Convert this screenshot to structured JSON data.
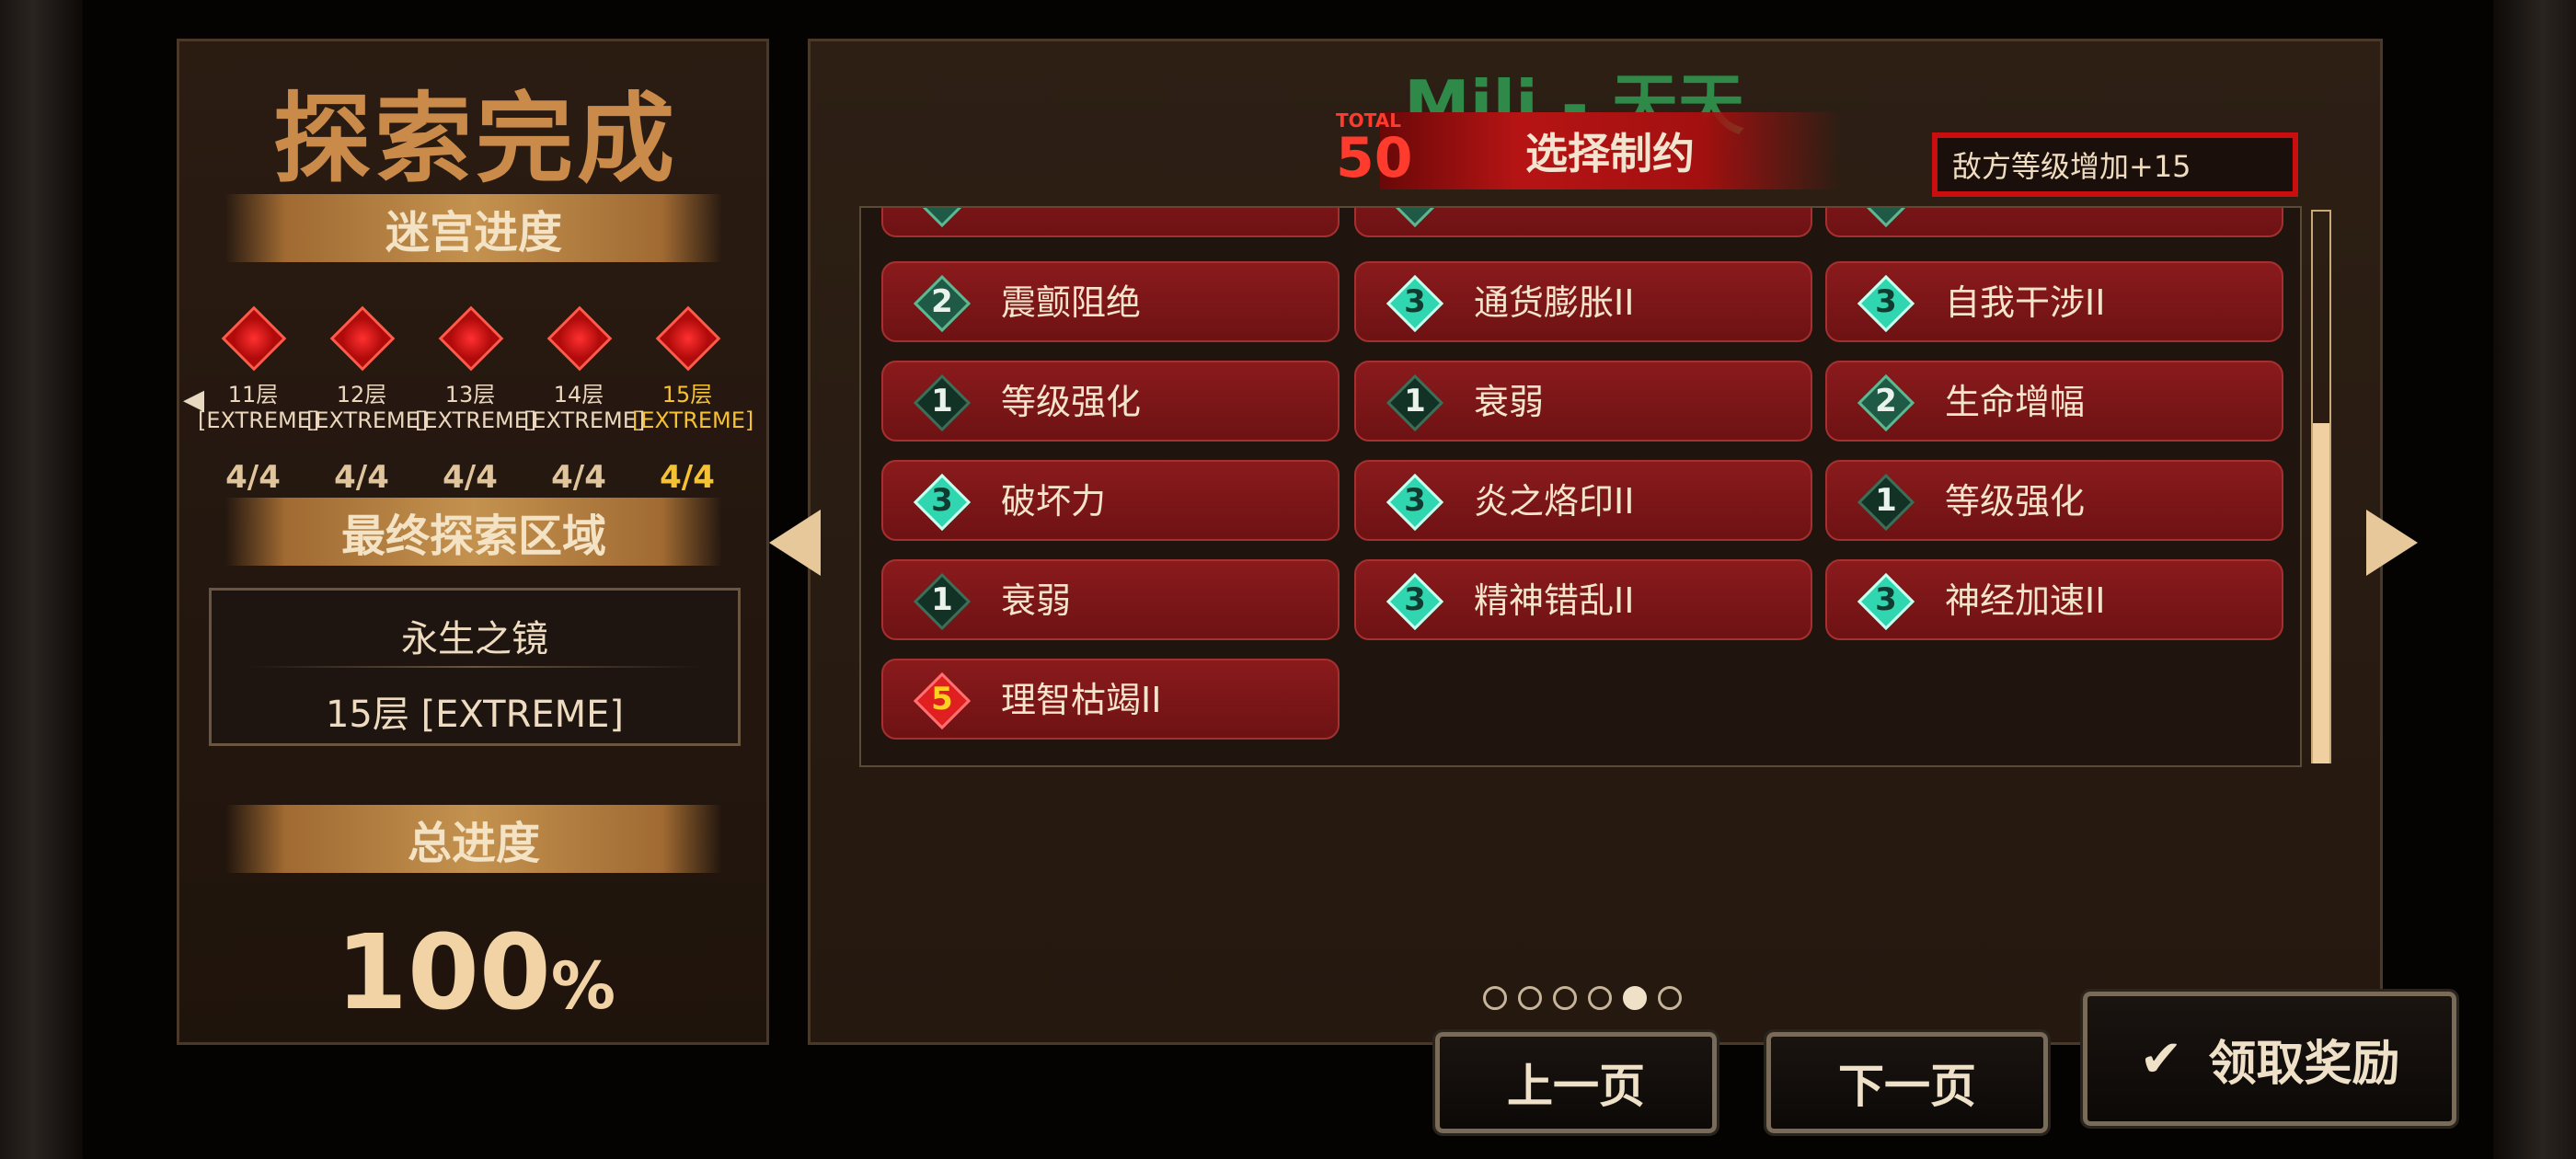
{
  "left_panel": {
    "title": "探索完成",
    "maze_progress_label": "迷宫进度",
    "floors": [
      {
        "label": "11层",
        "difficulty": "[EXTREME]",
        "count": "4/4"
      },
      {
        "label": "12层",
        "difficulty": "[EXTREME]",
        "count": "4/4"
      },
      {
        "label": "13层",
        "difficulty": "[EXTREME]",
        "count": "4/4"
      },
      {
        "label": "14层",
        "difficulty": "[EXTREME]",
        "count": "4/4"
      },
      {
        "label": "15层",
        "difficulty": "[EXTREME]",
        "count": "4/4"
      }
    ],
    "final_area_label": "最终探索区域",
    "final_area_name": "永生之镜",
    "final_area_floor": "15层 [EXTREME]",
    "total_progress_label": "总进度",
    "total_progress_value": "100",
    "total_progress_unit": "%"
  },
  "main_panel": {
    "title": "Mili - 天天",
    "total_label": "TOTAL",
    "total_value": "50",
    "limit_title": "选择制约",
    "enemy_level_text": "敌方等级增加+15",
    "restrictions": [
      {
        "level": "2",
        "name": "震颤阻绝"
      },
      {
        "level": "3",
        "name": "通货膨胀II"
      },
      {
        "level": "3",
        "name": "自我干涉II"
      },
      {
        "level": "1",
        "name": "等级强化"
      },
      {
        "level": "1",
        "name": "衰弱"
      },
      {
        "level": "2",
        "name": "生命增幅"
      },
      {
        "level": "3",
        "name": "破坏力"
      },
      {
        "level": "3",
        "name": "炎之烙印II"
      },
      {
        "level": "1",
        "name": "等级强化"
      },
      {
        "level": "1",
        "name": "衰弱"
      },
      {
        "level": "3",
        "name": "精神错乱II"
      },
      {
        "level": "3",
        "name": "神经加速II"
      },
      {
        "level": "5",
        "name": "理智枯竭II"
      }
    ],
    "page_count": 6,
    "current_page": 5
  },
  "buttons": {
    "prev": "上一页",
    "next": "下一页",
    "claim": "领取奖励"
  },
  "colors": {
    "accent_red": "#b61414",
    "title_green": "#2f8a4a",
    "active_floor_gold": "#f5c233"
  }
}
